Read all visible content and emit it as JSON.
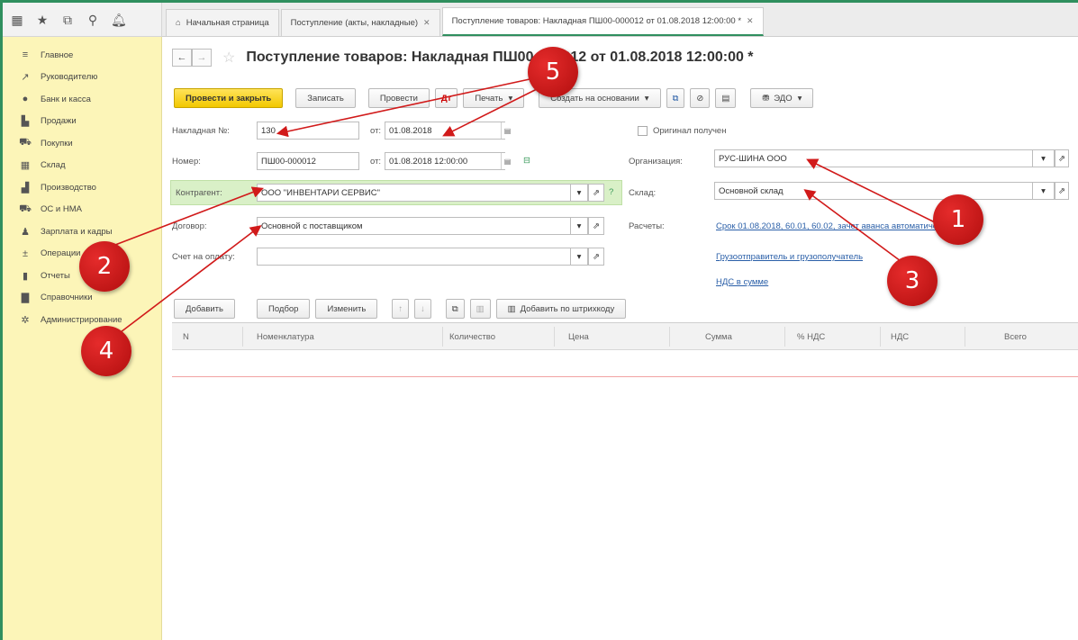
{
  "tabs": [
    {
      "label": "Начальная страница",
      "home": true
    },
    {
      "label": "Поступление (акты, накладные)",
      "close": "✕"
    },
    {
      "label": "Поступление товаров: Накладная ПШ00-000012 от 01.08.2018 12:00:00 *",
      "close": "✕",
      "active": true
    }
  ],
  "sidebar": {
    "items": [
      {
        "label": "Главное",
        "icon": "menu-icon"
      },
      {
        "label": "Руководителю",
        "icon": "chart-line-icon"
      },
      {
        "label": "Банк и касса",
        "icon": "bank-icon"
      },
      {
        "label": "Продажи",
        "icon": "sales-icon"
      },
      {
        "label": "Покупки",
        "icon": "cart-icon"
      },
      {
        "label": "Склад",
        "icon": "warehouse-icon"
      },
      {
        "label": "Производство",
        "icon": "production-icon"
      },
      {
        "label": "ОС и НМА",
        "icon": "truck-icon"
      },
      {
        "label": "Зарплата и кадры",
        "icon": "person-icon"
      },
      {
        "label": "Операции",
        "icon": "operations-icon"
      },
      {
        "label": "Отчеты",
        "icon": "reports-icon"
      },
      {
        "label": "Справочники",
        "icon": "book-icon"
      },
      {
        "label": "Администрирование",
        "icon": "gear-icon"
      }
    ]
  },
  "header": {
    "title": "Поступление товаров: Накладная ПШ00-000012 от 01.08.2018 12:00:00 *"
  },
  "toolbar": {
    "post_close": "Провести и закрыть",
    "save": "Записать",
    "post": "Провести",
    "print": "Печать",
    "create_based": "Создать на основании",
    "edo": "ЭДО"
  },
  "form": {
    "invoice_label": "Накладная №:",
    "invoice_value": "130",
    "from_label": "от:",
    "invoice_date": "01.08.2018",
    "original_label": "Оригинал получен",
    "number_label": "Номер:",
    "number_value": "ПШ00-000012",
    "number_date": "01.08.2018 12:00:00",
    "org_label": "Организация:",
    "org_value": "РУС-ШИНА ООО",
    "counterparty_label": "Контрагент:",
    "counterparty_value": "ООО \"ИНВЕНТАРИ СЕРВИС\"",
    "warehouse_label": "Склад:",
    "warehouse_value": "Основной склад",
    "contract_label": "Договор:",
    "contract_value": "Основной с поставщиком",
    "settlements_label": "Расчеты:",
    "settlements_link": "Срок 01.08.2018, 60.01, 60.02, зачет аванса автоматически",
    "payment_label": "Счет на оплату:",
    "shipper_link": "Грузоотправитель и грузополучатель",
    "vat_link": "НДС в сумме"
  },
  "table": {
    "buttons": {
      "add": "Добавить",
      "pick": "Подбор",
      "change": "Изменить",
      "barcode": "Добавить по штрихкоду"
    },
    "columns": [
      "N",
      "Номенклатура",
      "Количество",
      "Цена",
      "Сумма",
      "% НДС",
      "НДС",
      "Всего"
    ]
  },
  "badges": [
    "1",
    "2",
    "3",
    "4",
    "5"
  ],
  "colors": {
    "accent": "#2f8f5e",
    "sidebar": "#fcf5b8",
    "primary_button": "#f2c800",
    "badge": "#c81414",
    "link": "#2a5fa8"
  }
}
